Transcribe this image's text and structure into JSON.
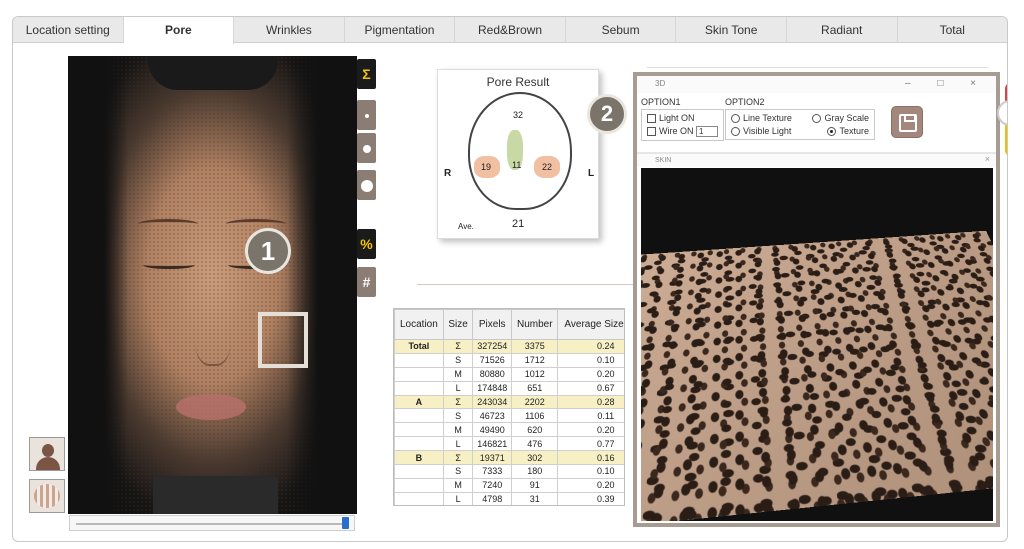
{
  "tabs": [
    "Location setting",
    "Pore",
    "Wrinkles",
    "Pigmentation",
    "Red&Brown",
    "Sebum",
    "Skin Tone",
    "Radiant",
    "Total"
  ],
  "active_tab": "Pore",
  "tools": {
    "sigma": "Σ",
    "percent": "%",
    "hash": "#"
  },
  "badges": {
    "one": "1",
    "two": "2"
  },
  "pore_result": {
    "title": "Pore Result",
    "forehead": "32",
    "nose": "11",
    "cheek_right": "19",
    "cheek_left": "22",
    "label_r": "R",
    "label_l": "L",
    "ave_label": "Ave.",
    "ave_value": "21"
  },
  "table": {
    "headers": [
      "Location",
      "Size",
      "Pixels",
      "Number",
      "Average Size(mm)"
    ],
    "rows": [
      [
        "Total",
        "Σ",
        "327254",
        "3375",
        "0.24"
      ],
      [
        "",
        "S",
        "71526",
        "1712",
        "0.10"
      ],
      [
        "",
        "M",
        "80880",
        "1012",
        "0.20"
      ],
      [
        "",
        "L",
        "174848",
        "651",
        "0.67"
      ],
      [
        "A",
        "Σ",
        "243034",
        "2202",
        "0.28"
      ],
      [
        "",
        "S",
        "46723",
        "1106",
        "0.11"
      ],
      [
        "",
        "M",
        "49490",
        "620",
        "0.20"
      ],
      [
        "",
        "L",
        "146821",
        "476",
        "0.77"
      ],
      [
        "B",
        "Σ",
        "19371",
        "302",
        "0.16"
      ],
      [
        "",
        "S",
        "7333",
        "180",
        "0.10"
      ],
      [
        "",
        "M",
        "7240",
        "91",
        "0.20"
      ],
      [
        "",
        "L",
        "4798",
        "31",
        "0.39"
      ]
    ]
  },
  "window3d": {
    "title": "3D",
    "controls": "–  □  ×",
    "option1": {
      "label": "OPTION1",
      "light": "Light ON",
      "wire": "Wire ON",
      "wire_value": "1"
    },
    "option2": {
      "label": "OPTION2",
      "line_texture": "Line Texture",
      "gray_scale": "Gray Scale",
      "visible_light": "Visible Light",
      "texture": "Texture"
    },
    "sub_title": "SKIN",
    "sub_close": "×"
  }
}
